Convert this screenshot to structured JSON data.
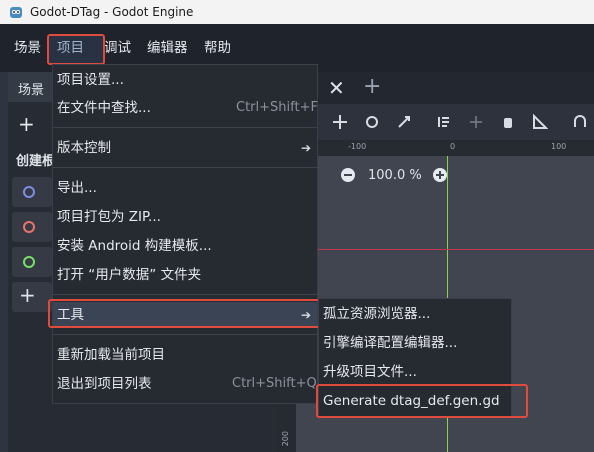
{
  "window": {
    "title": "Godot-DTag - Godot Engine"
  },
  "menubar": {
    "scene": "场景",
    "project": "项目",
    "debug": "调试",
    "editor": "编辑器",
    "help": "帮助"
  },
  "left_dock": {
    "tab_label": "场景",
    "create_label": "创建根",
    "node_colors": [
      "#7f8ce0",
      "#e9746b",
      "#74e06a"
    ]
  },
  "viewport": {
    "ruler_labels": [
      "-100",
      "0",
      "100"
    ],
    "zoom": "100.0 %",
    "ruler_left_label": "200"
  },
  "project_menu": {
    "items": [
      {
        "label": "项目设置...",
        "shortcut": ""
      },
      {
        "label": "在文件中查找...",
        "shortcut": "Ctrl+Shift+F"
      },
      {
        "label": "版本控制",
        "shortcut": ""
      },
      {
        "label": "导出...",
        "shortcut": ""
      },
      {
        "label": "项目打包为 ZIP...",
        "shortcut": ""
      },
      {
        "label": "安装 Android 构建模板...",
        "shortcut": ""
      },
      {
        "label": "打开 “用户数据” 文件夹",
        "shortcut": ""
      },
      {
        "label": "工具",
        "shortcut": ""
      },
      {
        "label": "重新加载当前项目",
        "shortcut": ""
      },
      {
        "label": "退出到项目列表",
        "shortcut": "Ctrl+Shift+Q"
      }
    ]
  },
  "tools_submenu": {
    "items": [
      {
        "label": "孤立资源浏览器..."
      },
      {
        "label": "引擎编译配置编辑器..."
      },
      {
        "label": "升级项目文件..."
      },
      {
        "label": "Generate dtag_def.gen.gd"
      }
    ]
  },
  "colors": {
    "highlight_border": "#e04b3e",
    "guide_green": "#8bd34a",
    "guide_red": "#c0394b"
  }
}
